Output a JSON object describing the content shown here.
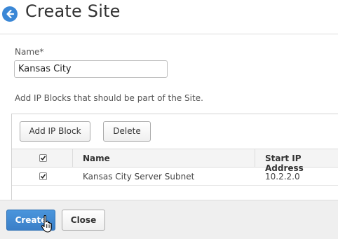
{
  "header": {
    "title": "Create Site"
  },
  "form": {
    "name_label": "Name*",
    "name_value": "Kansas City",
    "info_text": "Add IP Blocks that should be part of the Site."
  },
  "ip_block_toolbar": {
    "add_label": "Add IP Block",
    "delete_label": "Delete"
  },
  "table": {
    "columns": [
      "Name",
      "Start IP Address"
    ],
    "header_checked": true,
    "rows": [
      {
        "checked": true,
        "name": "Kansas City Server Subnet",
        "start_ip": "10.2.2.0"
      }
    ]
  },
  "footer": {
    "create_label": "Create",
    "close_label": "Close"
  },
  "colors": {
    "accent": "#3a87d6",
    "primary_button": "#4a95dc"
  },
  "icons": {
    "back": "back-arrow-icon",
    "cursor": "hand-pointer-icon"
  }
}
